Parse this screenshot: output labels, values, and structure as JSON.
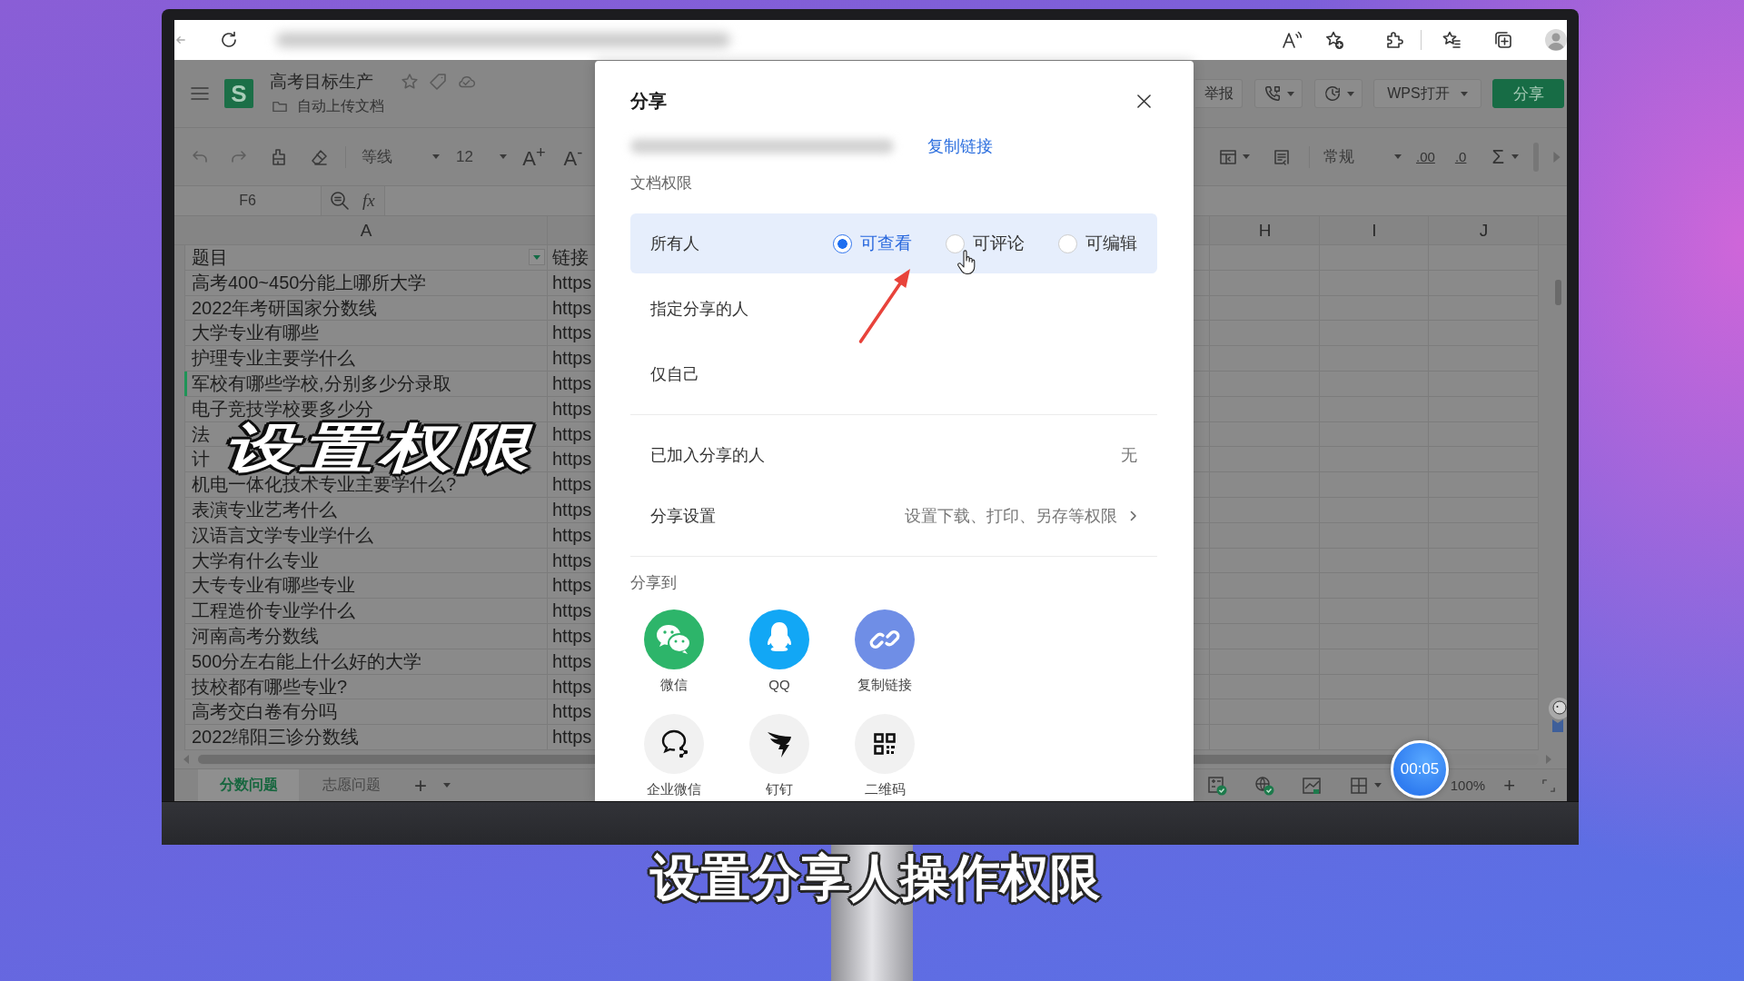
{
  "document": {
    "app_logo": "S",
    "title": "高考目标生产",
    "location": "自动上传文档"
  },
  "header_actions": {
    "report": "举报",
    "open_in_wps": "WPS打开",
    "share": "分享"
  },
  "toolbar": {
    "font": "等线",
    "font_size": "12",
    "grow_font": "A$^{+}$",
    "shrink_font": "A$^{-}$",
    "number_format": "常规",
    "increase_decimal": ".00",
    "decrease_decimal": ".0",
    "sum": "Σ"
  },
  "formula_bar": {
    "cell_ref": "F6",
    "fx": "fx"
  },
  "grid": {
    "columns_left": [
      "A"
    ],
    "columns_right": [
      "H",
      "I",
      "J"
    ],
    "header_row": {
      "title": "题目",
      "link": "链接"
    },
    "rows": [
      {
        "title": "高考400~450分能上哪所大学",
        "link": "https",
        "selected": false
      },
      {
        "title": "2022年考研国家分数线",
        "link": "https",
        "selected": false
      },
      {
        "title": "大学专业有哪些",
        "link": "https",
        "selected": false
      },
      {
        "title": "护理专业主要学什么",
        "link": "https",
        "selected": false
      },
      {
        "title": "军校有哪些学校,分别多少分录取",
        "link": "https",
        "selected": true
      },
      {
        "title": "电子竞技学校要多少分",
        "link": "https",
        "selected": false
      },
      {
        "title": "法",
        "link": "https",
        "selected": false
      },
      {
        "title": "计",
        "link": "https",
        "selected": false
      },
      {
        "title": "机电一体化技术专业主要学什么?",
        "link": "https",
        "selected": false
      },
      {
        "title": "表演专业艺考什么",
        "link": "https",
        "selected": false
      },
      {
        "title": "汉语言文学专业学什么",
        "link": "https",
        "selected": false
      },
      {
        "title": "大学有什么专业",
        "link": "https",
        "selected": false
      },
      {
        "title": "大专专业有哪些专业",
        "link": "https",
        "selected": false
      },
      {
        "title": "工程造价专业学什么",
        "link": "https",
        "selected": false
      },
      {
        "title": "河南高考分数线",
        "link": "https",
        "selected": false
      },
      {
        "title": "500分左右能上什么好的大学",
        "link": "https",
        "selected": false
      },
      {
        "title": "技校都有哪些专业?",
        "link": "https",
        "selected": false
      },
      {
        "title": "高考交白卷有分吗",
        "link": "https",
        "selected": false
      },
      {
        "title": "2022绵阳三诊分数线",
        "link": "https",
        "selected": false
      }
    ]
  },
  "sheet_tabs": [
    {
      "label": "分数问题",
      "selected": true
    },
    {
      "label": "志愿问题",
      "selected": false
    }
  ],
  "add_sheet": "+",
  "status_bar": {
    "zoom_level": "100%",
    "zoom_in": "+"
  },
  "timer": "00:05",
  "share_dialog": {
    "title": "分享",
    "copy_link": "复制链接",
    "permission_label": "文档权限",
    "scopes": [
      {
        "label": "所有人",
        "selected": true,
        "access": [
          {
            "label": "可查看",
            "selected": true
          },
          {
            "label": "可评论",
            "selected": false
          },
          {
            "label": "可编辑",
            "selected": false
          }
        ]
      },
      {
        "label": "指定分享的人",
        "selected": false
      },
      {
        "label": "仅自己",
        "selected": false
      }
    ],
    "settings": [
      {
        "label": "已加入分享的人",
        "value": "无",
        "kind": "info"
      },
      {
        "label": "分享设置",
        "value": "设置下载、打印、另存等权限",
        "kind": "link"
      }
    ],
    "share_to_label": "分享到",
    "targets": [
      {
        "label": "微信",
        "kind": "chat-bubbles"
      },
      {
        "label": "QQ",
        "kind": "penguin"
      },
      {
        "label": "复制链接",
        "kind": "chain"
      },
      {
        "label": "企业微信",
        "kind": "chat-outline"
      },
      {
        "label": "钉钉",
        "kind": "wing"
      },
      {
        "label": "二维码",
        "kind": "qr"
      }
    ]
  },
  "captions": {
    "overlay": "设置权限",
    "subtitle": "设置分享人操作权限"
  }
}
